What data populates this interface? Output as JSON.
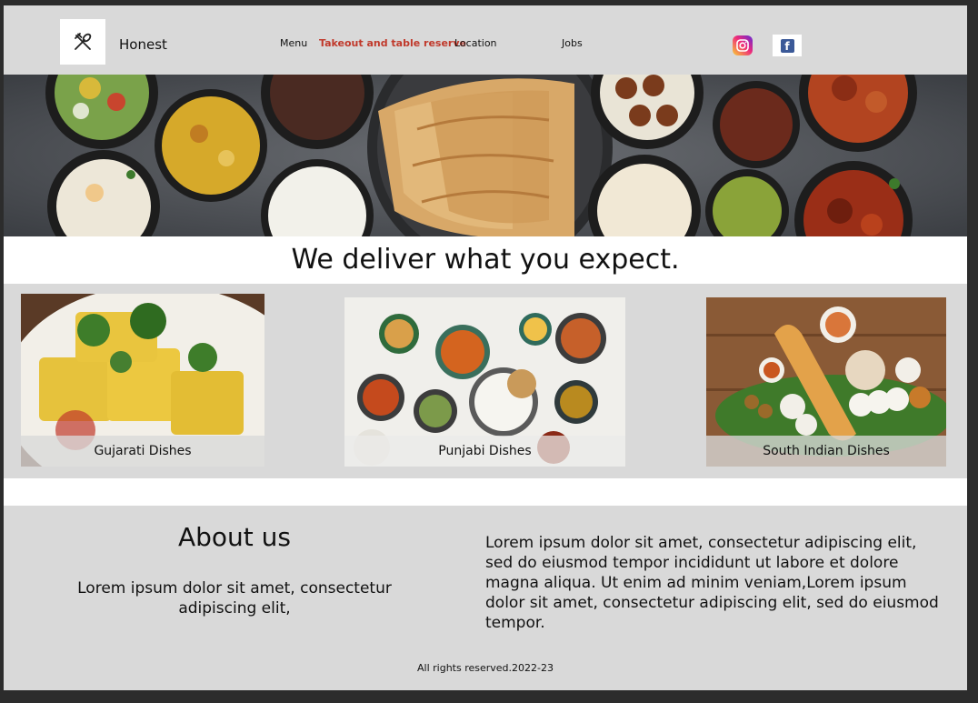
{
  "brand": {
    "name": "Honest",
    "logo_icon": "utensils-icon"
  },
  "nav": {
    "menu": "Menu",
    "takeout": "Takeout and table reserve",
    "location": "Location",
    "jobs": "Jobs"
  },
  "social": {
    "instagram_icon": "instagram-icon",
    "facebook_icon": "facebook-icon",
    "facebook_glyph": "f"
  },
  "tagline": "We deliver what you expect.",
  "cards": [
    {
      "label": "Gujarati Dishes"
    },
    {
      "label": "Punjabi Dishes"
    },
    {
      "label": "South Indian Dishes"
    }
  ],
  "about": {
    "title": "About us",
    "left_text": "Lorem ipsum dolor sit amet, consectetur adipiscing elit,",
    "right_text": "Lorem ipsum dolor sit amet, consectetur adipiscing elit, sed do eiusmod tempor incididunt ut labore et dolore magna aliqua. Ut enim ad minim veniam,Lorem ipsum dolor sit amet, consectetur adipiscing elit, sed do eiusmod tempor."
  },
  "footer": "All rights reserved.2022-23",
  "colors": {
    "active_nav": "#c0392b",
    "background": "#d9d9d9",
    "facebook": "#3b5998"
  }
}
